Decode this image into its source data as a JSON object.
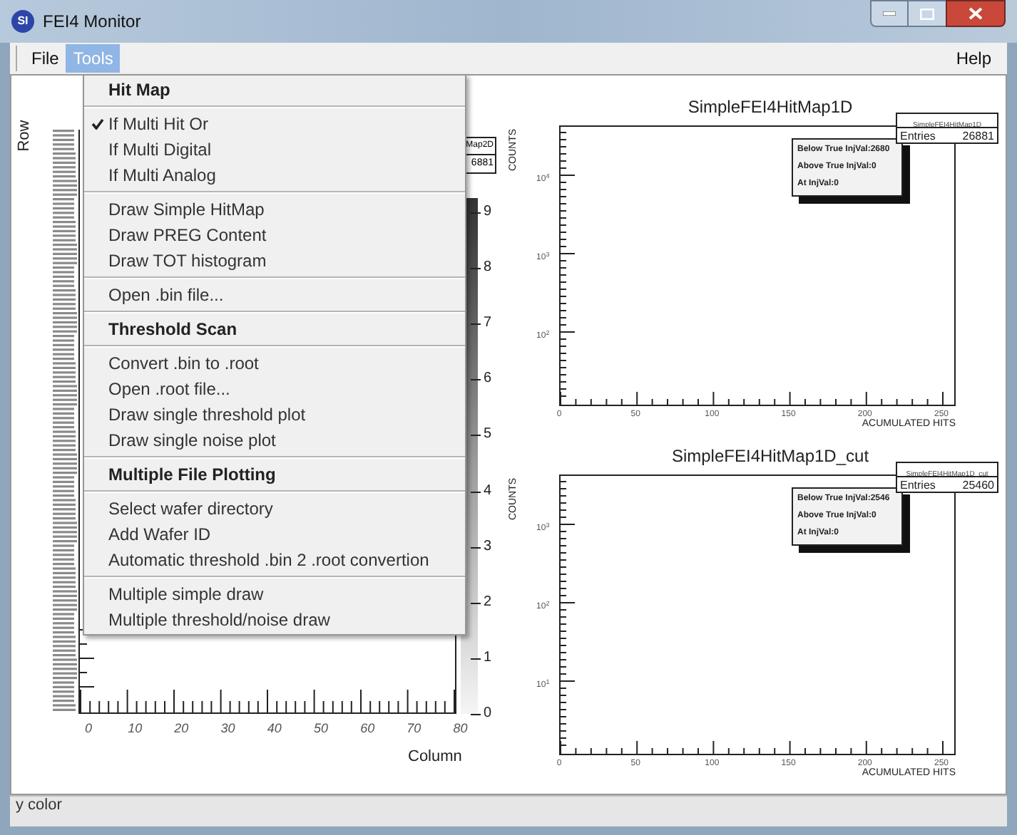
{
  "window": {
    "icon_text": "SI",
    "title": "FEI4 Monitor"
  },
  "menubar": [
    {
      "label": "File",
      "selected": false
    },
    {
      "label": "Tools",
      "selected": true
    },
    {
      "label": "Help",
      "selected": false
    }
  ],
  "tools_menu": {
    "groups": [
      [
        {
          "kind": "header",
          "label": "Hit Map"
        }
      ],
      [
        {
          "kind": "check",
          "label": "If Multi Hit Or",
          "checked": true
        },
        {
          "kind": "check",
          "label": "If Multi Digital",
          "checked": false
        },
        {
          "kind": "check",
          "label": "If Multi Analog",
          "checked": false
        }
      ],
      [
        {
          "kind": "item",
          "label": "Draw Simple HitMap"
        },
        {
          "kind": "item",
          "label": "Draw PREG Content"
        },
        {
          "kind": "item",
          "label": "Draw TOT histogram"
        }
      ],
      [
        {
          "kind": "item",
          "label": "Open .bin file..."
        }
      ],
      [
        {
          "kind": "header",
          "label": "Threshold Scan"
        }
      ],
      [
        {
          "kind": "item",
          "label": "Convert .bin to .root"
        },
        {
          "kind": "item",
          "label": "Open .root file..."
        },
        {
          "kind": "item",
          "label": "Draw single threshold plot"
        },
        {
          "kind": "item",
          "label": "Draw single noise plot"
        }
      ],
      [
        {
          "kind": "header",
          "label": "Multiple File Plotting"
        }
      ],
      [
        {
          "kind": "item",
          "label": "Select wafer directory"
        },
        {
          "kind": "item",
          "label": "Add Wafer ID"
        },
        {
          "kind": "item",
          "label": "Automatic threshold .bin 2 .root convertion"
        }
      ],
      [
        {
          "kind": "item",
          "label": "Multiple simple draw"
        },
        {
          "kind": "item",
          "label": "Multiple threshold/noise draw"
        }
      ]
    ]
  },
  "hitmap_2d": {
    "ylabel": "Row",
    "xlabel": "Column",
    "xticks": [
      "0",
      "10",
      "20",
      "30",
      "40",
      "50",
      "60",
      "70",
      "80"
    ],
    "color_scale": [
      "9",
      "8",
      "7",
      "6",
      "5",
      "4",
      "3",
      "2",
      "1",
      "0"
    ],
    "stats_box": {
      "title": "Map2D",
      "entries": "6881"
    }
  },
  "histograms": [
    {
      "title": "SimpleFEI4HitMap1D",
      "ylabel": "COUNTS",
      "xlabel": "ACUMULATED HITS",
      "yticks": [
        "10$^{4}$",
        "10$^{3}$",
        "10$^{2}$"
      ],
      "xticks": [
        "0",
        "50",
        "100",
        "150",
        "200",
        "250"
      ],
      "stats_box": {
        "title": "SimpleFEI4HitMap1D",
        "label": "Entries",
        "entries": "26881"
      },
      "legend": [
        "Below True InjVal:2680",
        "Above True InjVal:0",
        "At InjVal:0"
      ]
    },
    {
      "title": "SimpleFEI4HitMap1D_cut",
      "ylabel": "COUNTS",
      "xlabel": "ACUMULATED HITS",
      "yticks": [
        "10$^{3}$",
        "10$^{2}$",
        "10$^{1}$"
      ],
      "xticks": [
        "0",
        "50",
        "100",
        "150",
        "200",
        "250"
      ],
      "stats_box": {
        "title": "SimpleFEI4HitMap1D_cut",
        "label": "Entries",
        "entries": "25460"
      },
      "legend": [
        "Below True InjVal:2546",
        "Above True InjVal:0",
        "At InjVal:0"
      ]
    }
  ],
  "status_bar": "y color"
}
